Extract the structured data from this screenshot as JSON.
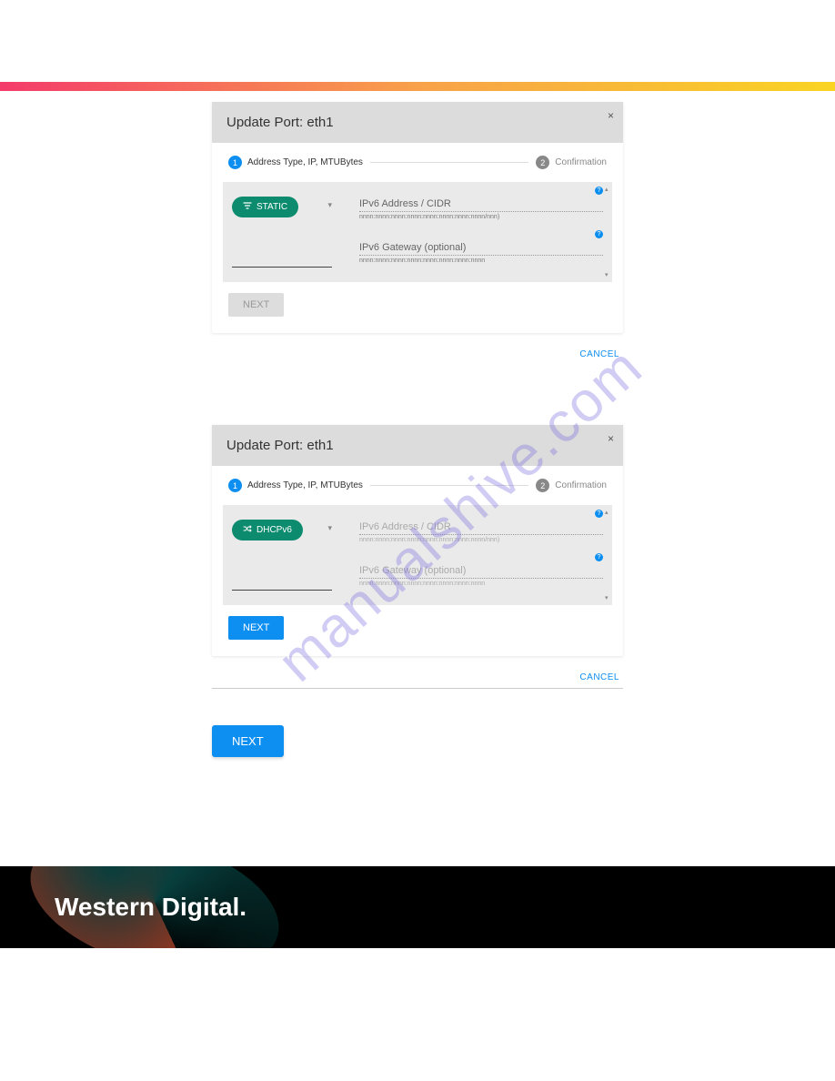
{
  "dialogs": [
    {
      "title": "Update Port: eth1",
      "close": "×",
      "step1_num": "1",
      "step1_label": "Address Type, IP, MTUBytes",
      "step2_num": "2",
      "step2_label": "Confirmation",
      "chip_type": "static",
      "chip_label": "STATIC",
      "fields": [
        {
          "label": "IPv6 Address / CIDR",
          "hint": "nnnn:nnnn:nnnn:nnnn:nnnn:nnnn:nnnn:nnnn/nnn)"
        },
        {
          "label": "IPv6 Gateway (optional)",
          "hint": "nnnn:nnnn:nnnn:nnnn:nnnn:nnnn:nnnn:nnnn"
        }
      ],
      "next_label": "NEXT",
      "next_enabled": false,
      "cancel_label": "CANCEL"
    },
    {
      "title": "Update Port: eth1",
      "close": "×",
      "step1_num": "1",
      "step1_label": "Address Type, IP, MTUBytes",
      "step2_num": "2",
      "step2_label": "Confirmation",
      "chip_type": "dhcpv6",
      "chip_label": "DHCPv6",
      "fields": [
        {
          "label": "IPv6 Address / CIDR",
          "hint": "nnnn:nnnn:nnnn:nnnn:nnnn:nnnn:nnnn:nnnn/nnn)"
        },
        {
          "label": "IPv6 Gateway (optional)",
          "hint": "nnnn:nnnn:nnnn:nnnn:nnnn:nnnn:nnnn:nnnn"
        }
      ],
      "next_label": "NEXT",
      "next_enabled": true,
      "cancel_label": "CANCEL"
    }
  ],
  "big_next": "NEXT",
  "watermark": "manualshive.com",
  "footer_brand": "Western Digital."
}
